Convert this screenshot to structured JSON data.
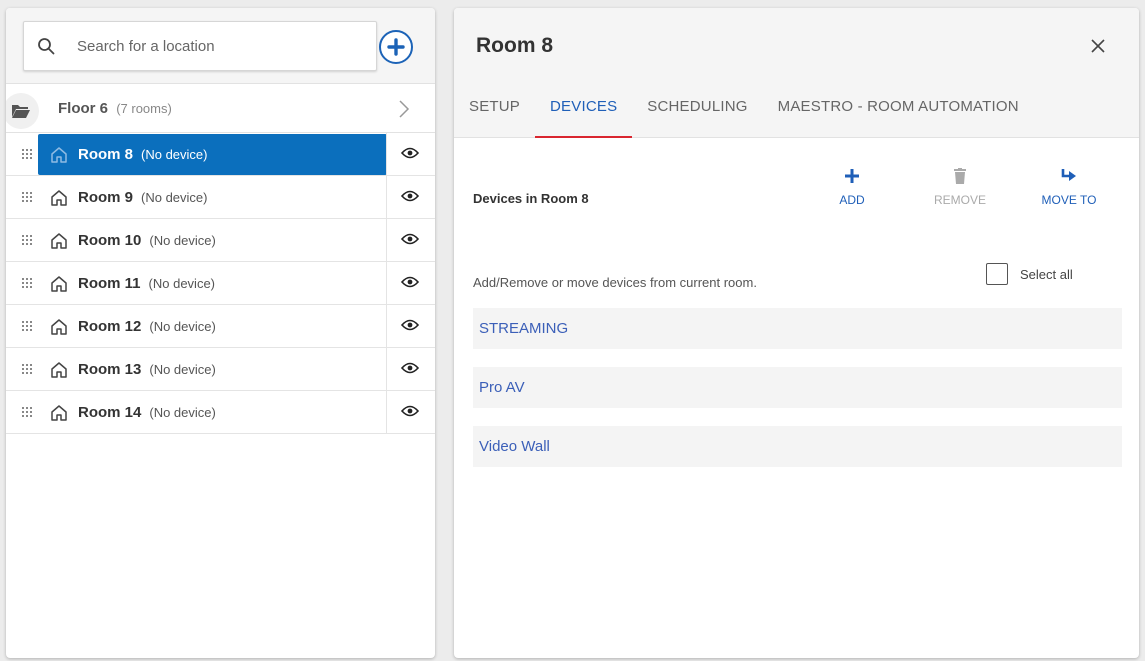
{
  "search": {
    "placeholder": "Search for a location"
  },
  "floor": {
    "name": "Floor 6",
    "count": "(7 rooms)"
  },
  "rooms": [
    {
      "name": "Room 8",
      "note": "(No device)",
      "selected": true
    },
    {
      "name": "Room 9",
      "note": "(No device)",
      "selected": false
    },
    {
      "name": "Room 10",
      "note": "(No device)",
      "selected": false
    },
    {
      "name": "Room 11",
      "note": "(No device)",
      "selected": false
    },
    {
      "name": "Room 12",
      "note": "(No device)",
      "selected": false
    },
    {
      "name": "Room 13",
      "note": "(No device)",
      "selected": false
    },
    {
      "name": "Room 14",
      "note": "(No device)",
      "selected": false
    }
  ],
  "detail": {
    "title": "Room 8",
    "tabs": [
      {
        "label": "SETUP",
        "active": false
      },
      {
        "label": "DEVICES",
        "active": true
      },
      {
        "label": "SCHEDULING",
        "active": false
      },
      {
        "label": "MAESTRO - ROOM AUTOMATION",
        "active": false
      }
    ],
    "devices_title": "Devices in Room 8",
    "actions": {
      "add": "ADD",
      "remove": "REMOVE",
      "move_to": "MOVE TO"
    },
    "helper": "Add/Remove or move devices from current room.",
    "select_all": "Select all",
    "devices": [
      "STREAMING",
      "Pro AV",
      "Video Wall"
    ]
  },
  "colors": {
    "accent": "#1f5fb8",
    "selected_row": "#0b6fbd",
    "active_tab_underline": "#d9262f",
    "disabled": "#aaaaaa"
  }
}
